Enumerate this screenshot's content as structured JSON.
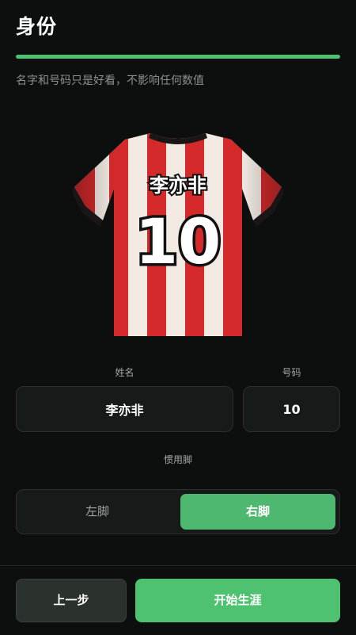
{
  "header": {
    "title": "身份",
    "progress": 1.0
  },
  "subtitle": "名字和号码只是好看，不影响任何数值",
  "jersey": {
    "name": "李亦非",
    "number": "10",
    "colors": {
      "red": "#d42a2c",
      "white": "#f1e9e2",
      "trim": "#1a1616"
    }
  },
  "form": {
    "name_label": "姓名",
    "name_value": "李亦非",
    "number_label": "号码",
    "number_value": "10",
    "foot_label": "惯用脚",
    "foot_options": [
      "左脚",
      "右脚"
    ],
    "foot_selected": "右脚"
  },
  "footer": {
    "back_label": "上一步",
    "start_label": "开始生涯"
  },
  "theme": {
    "accent": "#4fc271",
    "background": "#0d0f0e"
  }
}
